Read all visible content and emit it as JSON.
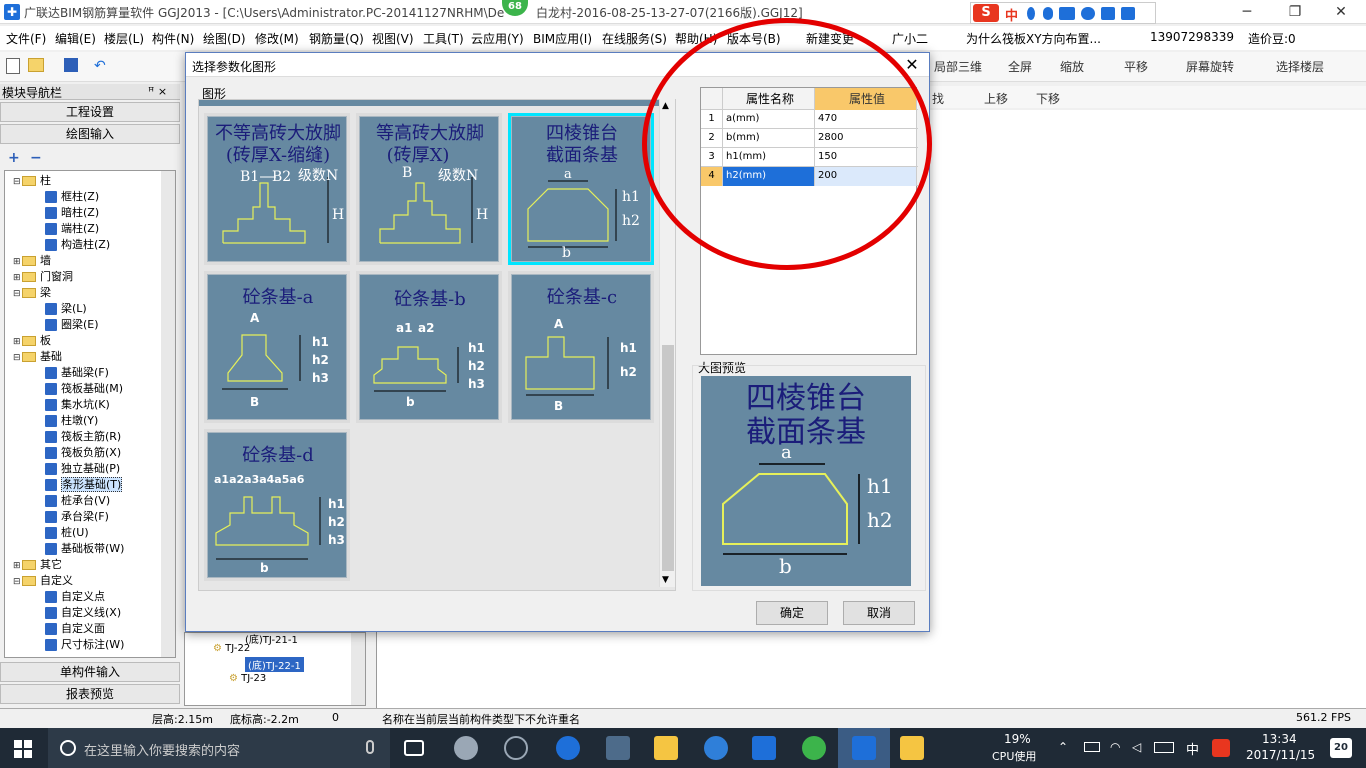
{
  "window": {
    "title": "广联达BIM钢筋算量软件 GGJ2013 - [C:\\Users\\Administrator.PC-20141127NRHM\\De",
    "title_tail": "白龙村-2016-08-25-13-27-07(2166版).GGJ12]",
    "badge": "68",
    "minimize": "─",
    "restore": "❐",
    "close": "✕"
  },
  "ime": {
    "logo": "S",
    "mode": "中"
  },
  "menu": {
    "items": [
      "文件(F)",
      "编辑(E)",
      "楼层(L)",
      "构件(N)",
      "绘图(D)",
      "修改(M)",
      "钢筋量(Q)",
      "视图(V)",
      "工具(T)",
      "云应用(Y)",
      "BIM应用(I)",
      "在线服务(S)",
      "帮助(H)",
      "版本号(B)",
      "新建变更",
      "广小二"
    ],
    "ad": "为什么筏板XY方向布置...",
    "phone": "13907298339",
    "cost": "造价豆:0"
  },
  "toolbar": {
    "right_items": [
      "局部三维",
      "全屏",
      "缩放",
      "平移",
      "屏幕旋转",
      "选择楼层"
    ],
    "second_row": [
      "找",
      "上移",
      "下移"
    ]
  },
  "left_panel": {
    "title": "模块导航栏",
    "pin": "ꟸ ×",
    "btn_project": "工程设置",
    "btn_drawing": "绘图输入",
    "btn_single": "单构件输入",
    "btn_report": "报表预览",
    "tree": [
      {
        "label": "柱",
        "exp": "⊟",
        "folder": true
      },
      {
        "label": "框柱(Z)",
        "leaf": true
      },
      {
        "label": "暗柱(Z)",
        "leaf": true
      },
      {
        "label": "端柱(Z)",
        "leaf": true
      },
      {
        "label": "构造柱(Z)",
        "leaf": true
      },
      {
        "label": "墙",
        "exp": "⊞",
        "folder": true
      },
      {
        "label": "门窗洞",
        "exp": "⊞",
        "folder": true
      },
      {
        "label": "梁",
        "exp": "⊟",
        "folder": true
      },
      {
        "label": "梁(L)",
        "leaf": true
      },
      {
        "label": "圈梁(E)",
        "leaf": true
      },
      {
        "label": "板",
        "exp": "⊞",
        "folder": true
      },
      {
        "label": "基础",
        "exp": "⊟",
        "folder": true
      },
      {
        "label": "基础梁(F)",
        "leaf": true
      },
      {
        "label": "筏板基础(M)",
        "leaf": true
      },
      {
        "label": "集水坑(K)",
        "leaf": true
      },
      {
        "label": "柱墩(Y)",
        "leaf": true
      },
      {
        "label": "筏板主筋(R)",
        "leaf": true
      },
      {
        "label": "筏板负筋(X)",
        "leaf": true
      },
      {
        "label": "独立基础(P)",
        "leaf": true
      },
      {
        "label": "条形基础(T)",
        "leaf": true,
        "selected": true
      },
      {
        "label": "桩承台(V)",
        "leaf": true
      },
      {
        "label": "承台梁(F)",
        "leaf": true
      },
      {
        "label": "桩(U)",
        "leaf": true
      },
      {
        "label": "基础板带(W)",
        "leaf": true
      },
      {
        "label": "其它",
        "exp": "⊞",
        "folder": true
      },
      {
        "label": "自定义",
        "exp": "⊟",
        "folder": true
      },
      {
        "label": "自定义点",
        "leaf": true
      },
      {
        "label": "自定义线(X)",
        "leaf": true
      },
      {
        "label": "自定义面",
        "leaf": true
      },
      {
        "label": "尺寸标注(W)",
        "leaf": true
      }
    ]
  },
  "mid_tree": {
    "items": [
      "(底)TJ-21-1",
      "TJ-22",
      "(底)TJ-22-1",
      "TJ-23"
    ]
  },
  "dialog": {
    "title": "选择参数化图形",
    "close": "✕",
    "group_label": "图形",
    "shapes": [
      {
        "name": "不等高砖大放脚(砖厚X-缩缝)",
        "line1": "不等高砖大放脚",
        "line2": "(砖厚X-缩缝)",
        "labels": [
          "B1",
          "B2",
          "级数N",
          "H"
        ]
      },
      {
        "name": "等高砖大放脚(砖厚X)",
        "line1": "等高砖大放脚",
        "line2": "(砖厚X)",
        "labels": [
          "B",
          "级数N",
          "H"
        ]
      },
      {
        "name": "四棱锥台截面条基",
        "line1": "四棱锥台",
        "line2": "截面条基",
        "labels": [
          "a",
          "h1",
          "h2",
          "b"
        ],
        "selected": true
      },
      {
        "name": "砼条基-a",
        "line1": "砼条基-a",
        "labels": [
          "A",
          "h1",
          "h2",
          "h3",
          "B"
        ]
      },
      {
        "name": "砼条基-b",
        "line1": "砼条基-b",
        "labels": [
          "a1",
          "a2",
          "h1",
          "h2",
          "h3",
          "b"
        ]
      },
      {
        "name": "砼条基-c",
        "line1": "砼条基-c",
        "labels": [
          "A",
          "h1",
          "h2",
          "B"
        ]
      },
      {
        "name": "砼条基-d",
        "line1": "砼条基-d",
        "labels": [
          "a1a2a3a4a5a6",
          "h1",
          "h2",
          "h3",
          "b"
        ]
      }
    ],
    "properties": {
      "col_name": "属性名称",
      "col_value": "属性值",
      "rows": [
        {
          "idx": "1",
          "name": "a(mm)",
          "value": "470"
        },
        {
          "idx": "2",
          "name": "b(mm)",
          "value": "2800"
        },
        {
          "idx": "3",
          "name": "h1(mm)",
          "value": "150"
        },
        {
          "idx": "4",
          "name": "h2(mm)",
          "value": "200",
          "selected": true
        }
      ]
    },
    "preview_label": "大图预览",
    "preview": {
      "line1": "四棱锥台",
      "line2": "截面条基",
      "a": "a",
      "h1": "h1",
      "h2": "h2",
      "b": "b"
    },
    "ok": "确定",
    "cancel": "取消"
  },
  "statusbar": {
    "floor_height": "层高:2.15m",
    "bottom_elev": "底标高:-2.2m",
    "zero": "0",
    "message": "名称在当前层当前构件类型下不允许重名",
    "fps": "561.2 FPS"
  },
  "taskbar": {
    "search_placeholder": "在这里输入你要搜索的内容",
    "cpu_percent": "19%",
    "cpu_label": "CPU使用",
    "ime": "中",
    "time": "13:34",
    "date": "2017/11/15",
    "notif": "20"
  }
}
